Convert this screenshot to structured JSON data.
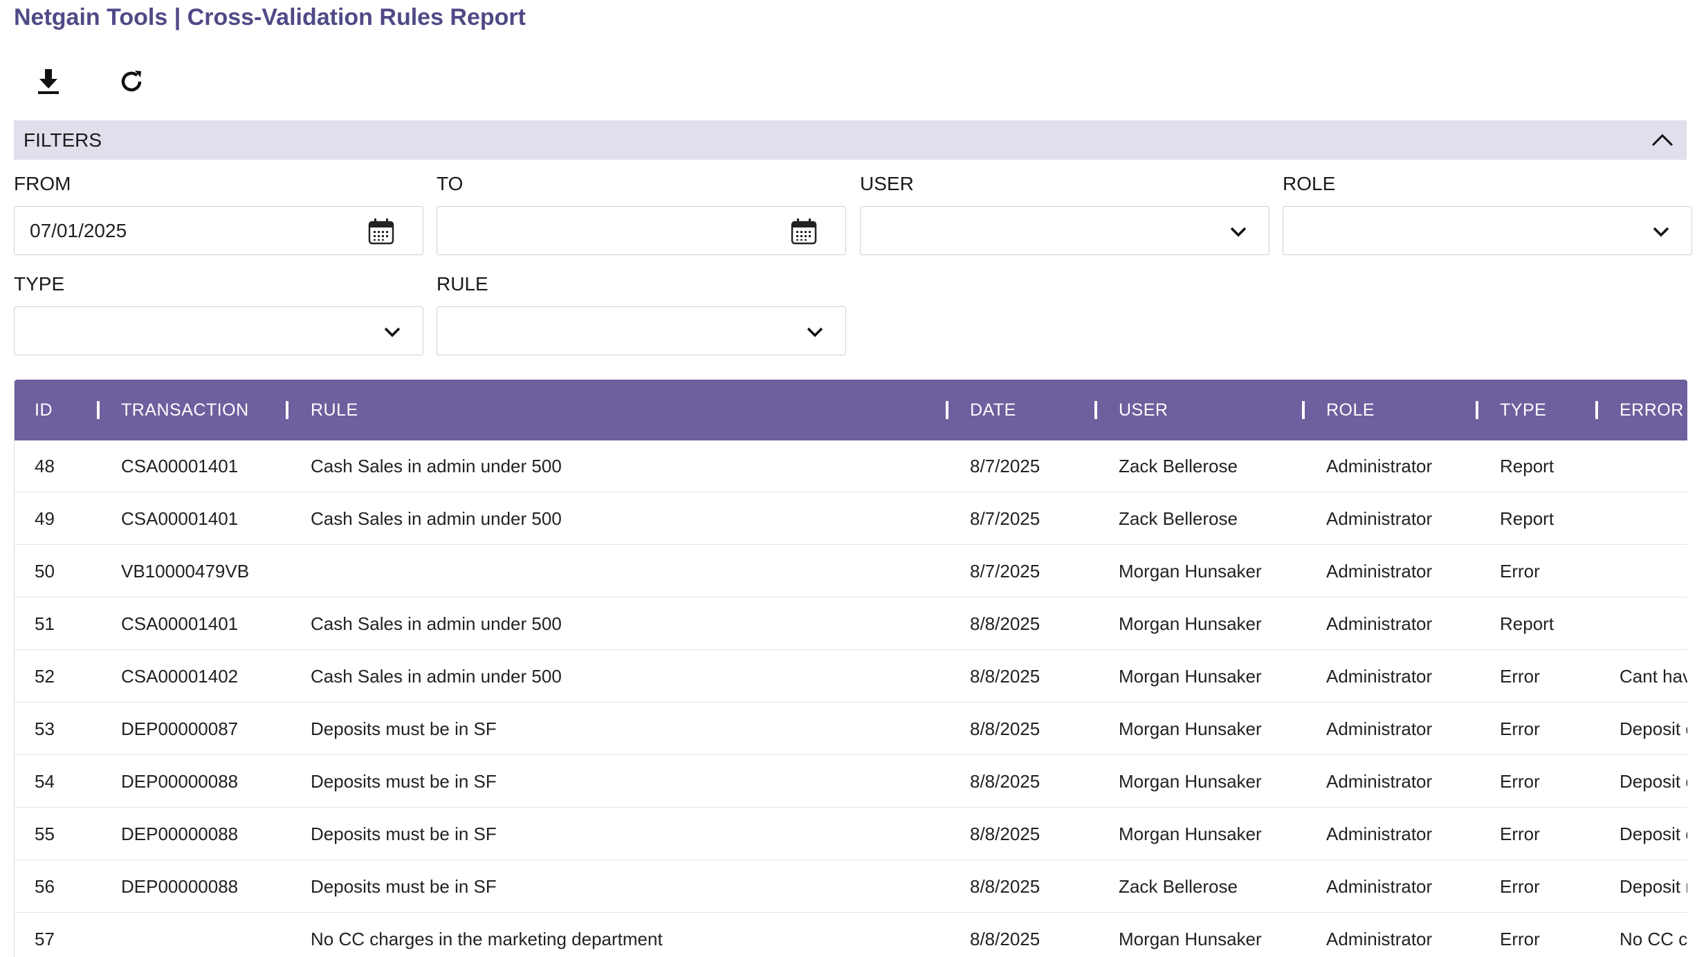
{
  "app_title": "Netgain Tools | Cross-Validation Rules Report",
  "toolbar": {
    "download_icon": "download-icon",
    "refresh_icon": "refresh-icon"
  },
  "filters": {
    "header": "FILTERS",
    "from": {
      "label": "FROM",
      "value": "07/01/2025"
    },
    "to": {
      "label": "TO",
      "value": ""
    },
    "user": {
      "label": "USER",
      "value": ""
    },
    "role": {
      "label": "ROLE",
      "value": ""
    },
    "type": {
      "label": "TYPE",
      "value": ""
    },
    "rule": {
      "label": "RULE",
      "value": ""
    }
  },
  "table": {
    "columns": [
      "ID",
      "TRANSACTION",
      "RULE",
      "DATE",
      "USER",
      "ROLE",
      "TYPE",
      "ERROR"
    ],
    "rows": [
      [
        "48",
        "CSA00001401",
        "Cash Sales in admin under 500",
        "8/7/2025",
        "Zack Bellerose",
        "Administrator",
        "Report",
        ""
      ],
      [
        "49",
        "CSA00001401",
        "Cash Sales in admin under 500",
        "8/7/2025",
        "Zack Bellerose",
        "Administrator",
        "Report",
        ""
      ],
      [
        "50",
        "VB10000479VB",
        "",
        "8/7/2025",
        "Morgan Hunsaker",
        "Administrator",
        "Error",
        ""
      ],
      [
        "51",
        "CSA00001401",
        "Cash Sales in admin under 500",
        "8/8/2025",
        "Morgan Hunsaker",
        "Administrator",
        "Report",
        ""
      ],
      [
        "52",
        "CSA00001402",
        "Cash Sales in admin under 500",
        "8/8/2025",
        "Morgan Hunsaker",
        "Administrator",
        "Error",
        "Cant have"
      ],
      [
        "53",
        "DEP00000087",
        "Deposits must be in SF",
        "8/8/2025",
        "Morgan Hunsaker",
        "Administrator",
        "Error",
        "Deposit ca"
      ],
      [
        "54",
        "DEP00000088",
        "Deposits must be in SF",
        "8/8/2025",
        "Morgan Hunsaker",
        "Administrator",
        "Error",
        "Deposit ca"
      ],
      [
        "55",
        "DEP00000088",
        "Deposits must be in SF",
        "8/8/2025",
        "Morgan Hunsaker",
        "Administrator",
        "Error",
        "Deposit ca"
      ],
      [
        "56",
        "DEP00000088",
        "Deposits must be in SF",
        "8/8/2025",
        "Zack Bellerose",
        "Administrator",
        "Error",
        "Deposit m"
      ],
      [
        "57",
        "",
        "No CC charges in the marketing department",
        "8/8/2025",
        "Morgan Hunsaker",
        "Administrator",
        "Error",
        "No CC cha"
      ]
    ]
  },
  "colors": {
    "title": "#4f4a86",
    "header_bg": "#6e5f9e",
    "filters_bg": "#e0dfec"
  }
}
